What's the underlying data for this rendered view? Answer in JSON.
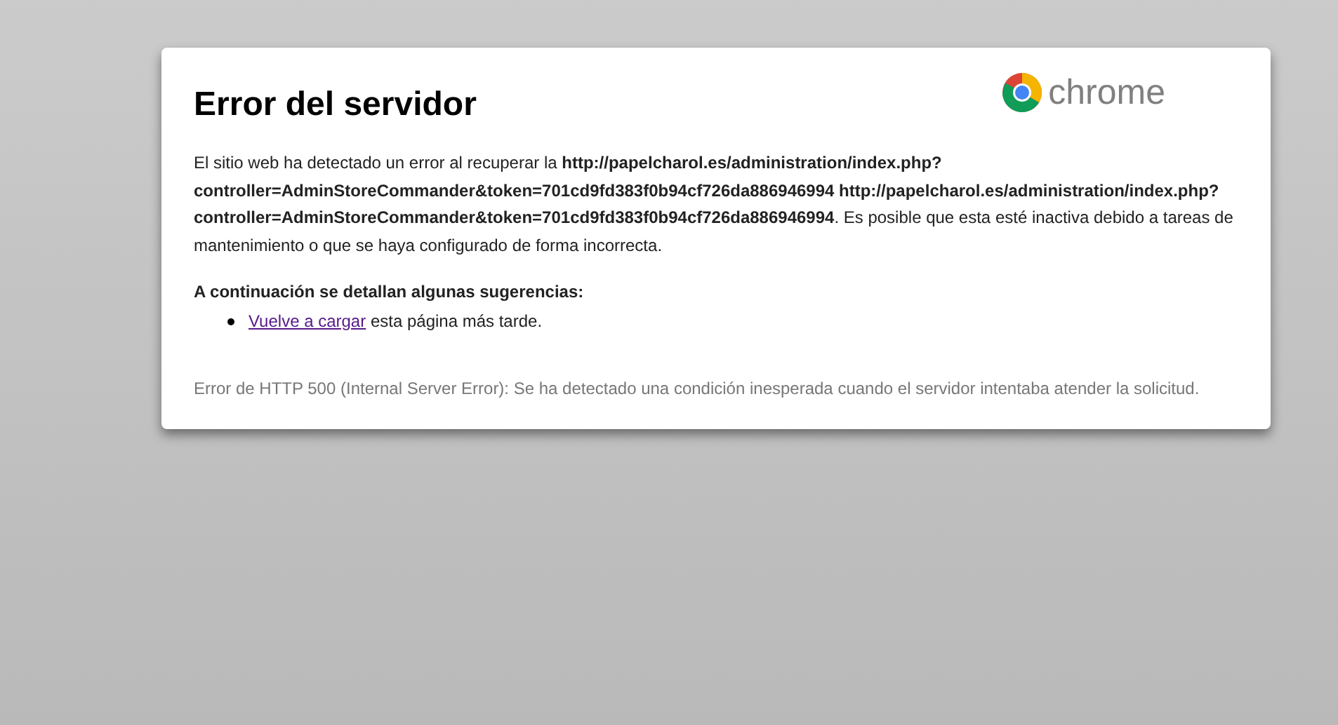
{
  "title": "Error del servidor",
  "logo": {
    "text": "chrome"
  },
  "message": "El sitio web ha detectado un error al recuperar la **http://papelcharol.es/administration/index.php?controller=AdminStoreCommander&token=701cd9fd383f0b94cf726da886946994 http://papelcharol.es/administration/index.php?controller=AdminStoreCommander&token=701cd9fd383f0b94cf726da886946994**. Es posible que esta esté inactiva debido a tareas de mantenimiento o que se haya configurado de forma incorrecta.",
  "suggestions_heading": "A continuación se detallan algunas sugerencias:",
  "suggestions": [
    {
      "link": "Vuelve a cargar",
      "text": "esta página más tarde."
    }
  ],
  "error_detail": "Error de HTTP 500 (Internal Server Error): Se ha detectado una condición inesperada cuando el servidor intentaba atender la solicitud."
}
